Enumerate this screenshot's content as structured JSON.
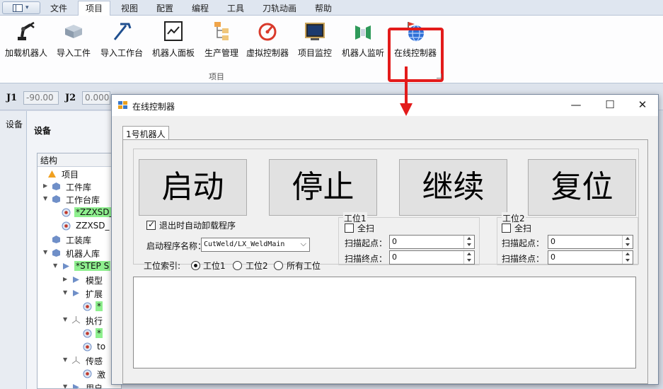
{
  "menu": {
    "tabs": [
      "文件",
      "项目",
      "视图",
      "配置",
      "编程",
      "工具",
      "刀轨动画",
      "帮助"
    ],
    "active_tab": "项目"
  },
  "ribbon": {
    "buttons": [
      {
        "label": "加载机器人",
        "icon": "robot-arm-icon"
      },
      {
        "label": "导入工件",
        "icon": "workpiece-box-icon"
      },
      {
        "label": "导入工作台",
        "icon": "workbench-tool-icon"
      },
      {
        "label": "机器人面板",
        "icon": "panel-chart-icon"
      },
      {
        "label": "生产管理",
        "icon": "production-tree-icon"
      },
      {
        "label": "虚拟控制器",
        "icon": "gauge-icon"
      },
      {
        "label": "项目监控",
        "icon": "monitor-screen-icon"
      },
      {
        "label": "机器人监听",
        "icon": "listen-icon"
      },
      {
        "label": "在线控制器",
        "icon": "globe-flag-icon"
      }
    ],
    "group_label": "项目",
    "highlight_color": "#e31b1b"
  },
  "joints": {
    "j1_label": "J1",
    "j1_value": "-90.00",
    "j2_label": "J2",
    "j2_value": "0.000"
  },
  "side_panel": {
    "tab_label": "设备",
    "title": "设备",
    "tree_header": "结构",
    "nodes": [
      {
        "label": "项目",
        "icon": "project-icon",
        "highlight": false
      },
      {
        "label": "工件库",
        "icon": "library-cube-icon",
        "highlight": false
      },
      {
        "label": "工作台库",
        "icon": "library-cube-icon",
        "highlight": false
      },
      {
        "label": "*ZZXSD_",
        "icon": "part-icon",
        "highlight": true
      },
      {
        "label": "ZZXSD_",
        "icon": "part-icon",
        "highlight": false
      },
      {
        "label": "工装库",
        "icon": "library-cube-icon",
        "highlight": false
      },
      {
        "label": "机器人库",
        "icon": "library-cube-icon",
        "highlight": false
      },
      {
        "label": "*STEP S",
        "icon": "robot-node-icon",
        "highlight": true
      },
      {
        "label": "模型",
        "icon": "model-icon",
        "highlight": false
      },
      {
        "label": "扩展",
        "icon": "model-icon",
        "highlight": false
      },
      {
        "label": "*",
        "icon": "part-icon",
        "highlight": true
      },
      {
        "label": "执行",
        "icon": "axis-icon",
        "highlight": false
      },
      {
        "label": "*",
        "icon": "part-icon",
        "highlight": true
      },
      {
        "label": "to",
        "icon": "part-icon",
        "highlight": false
      },
      {
        "label": "传感",
        "icon": "axis-icon",
        "highlight": false
      },
      {
        "label": "激",
        "icon": "part-icon",
        "highlight": false
      },
      {
        "label": "用户",
        "icon": "model-icon",
        "highlight": false
      }
    ]
  },
  "dialog": {
    "title": "在线控制器",
    "tab_label": "1号机器人",
    "buttons": {
      "start": "启动",
      "stop": "停止",
      "continue": "继续",
      "reset": "复位"
    },
    "unload_checkbox": {
      "label": "退出时自动卸载程序",
      "checked": true
    },
    "program_label": "启动程序名称：",
    "program_value": "CutWeld/LX_WeldMain",
    "station_index_label": "工位索引:",
    "station_options": [
      {
        "label": "工位1",
        "checked": true
      },
      {
        "label": "工位2",
        "checked": false
      },
      {
        "label": "所有工位",
        "checked": false
      }
    ],
    "station1": {
      "legend": "工位1",
      "full_scan_label": "全扫",
      "full_scan_checked": false,
      "scan_start_label": "扫描起点：",
      "scan_start_value": "0",
      "scan_end_label": "扫描终点：",
      "scan_end_value": "0"
    },
    "station2": {
      "legend": "工位2",
      "full_scan_label": "全扫",
      "full_scan_checked": false,
      "scan_start_label": "扫描起点：",
      "scan_start_value": "0",
      "scan_end_label": "扫描终点：",
      "scan_end_value": "0"
    },
    "window_controls": {
      "minimize": "—",
      "maximize": "☐",
      "close": "✕"
    }
  }
}
